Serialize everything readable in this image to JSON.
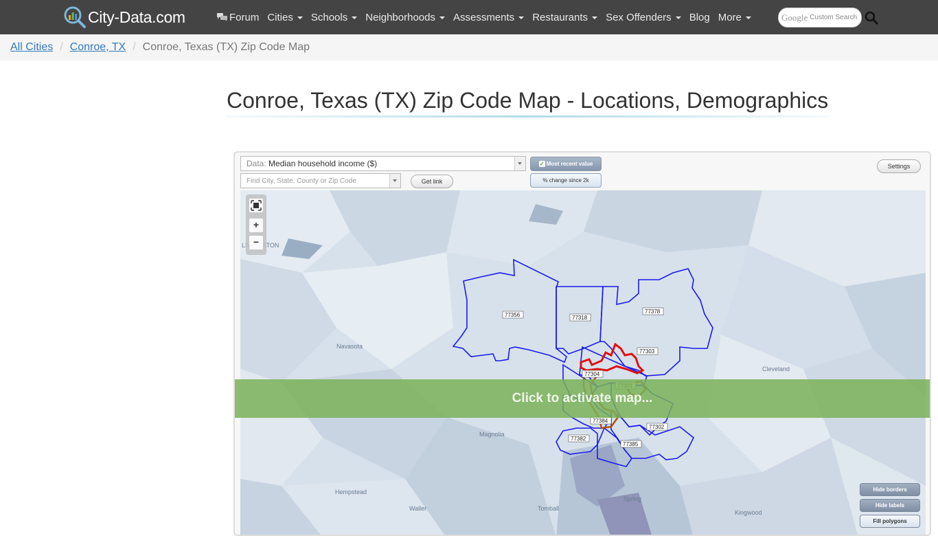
{
  "header": {
    "logo_text": "City-Data.com",
    "nav": [
      {
        "label": "Forum",
        "dropdown": false
      },
      {
        "label": "Cities",
        "dropdown": true
      },
      {
        "label": "Schools",
        "dropdown": true
      },
      {
        "label": "Neighborhoods",
        "dropdown": true
      },
      {
        "label": "Assessments",
        "dropdown": true
      },
      {
        "label": "Restaurants",
        "dropdown": true
      },
      {
        "label": "Sex Offenders",
        "dropdown": true
      },
      {
        "label": "Blog",
        "dropdown": false
      },
      {
        "label": "More",
        "dropdown": true
      }
    ],
    "search_brand": "Google",
    "search_placeholder": "Custom Search"
  },
  "breadcrumb": {
    "items": [
      "All Cities",
      "Conroe, TX"
    ],
    "current": "Conroe, Texas (TX) Zip Code Map"
  },
  "page_title": "Conroe, Texas (TX) Zip Code Map - Locations, Demographics",
  "map": {
    "data_label": "Data:",
    "data_value": "Median household income ($)",
    "find_placeholder": "Find City, State, County or Zip Code",
    "get_link": "Get link",
    "most_recent": "Most recent value",
    "change_since": "% change since 2k",
    "settings": "Settings",
    "overlay_text": "Click to activate map...",
    "hide_borders": "Hide borders",
    "hide_labels": "Hide labels",
    "fill_polygons": "Fill polygons",
    "zip_codes": [
      "77356",
      "77318",
      "77378",
      "77303",
      "77304",
      "77301",
      "77384",
      "77302",
      "77382",
      "77385"
    ],
    "place_names": [
      "Navasota",
      "Cleveland",
      "Magnolia",
      "Tomball",
      "Hempstead",
      "Waller",
      "Spring",
      "Kingwood",
      "LIVINGSTON"
    ]
  },
  "colors": {
    "navbar_bg": "#444444",
    "link": "#337ab7",
    "overlay": "#7ab258",
    "zip_border": "#1a1aee",
    "city_border": "#e01010"
  }
}
